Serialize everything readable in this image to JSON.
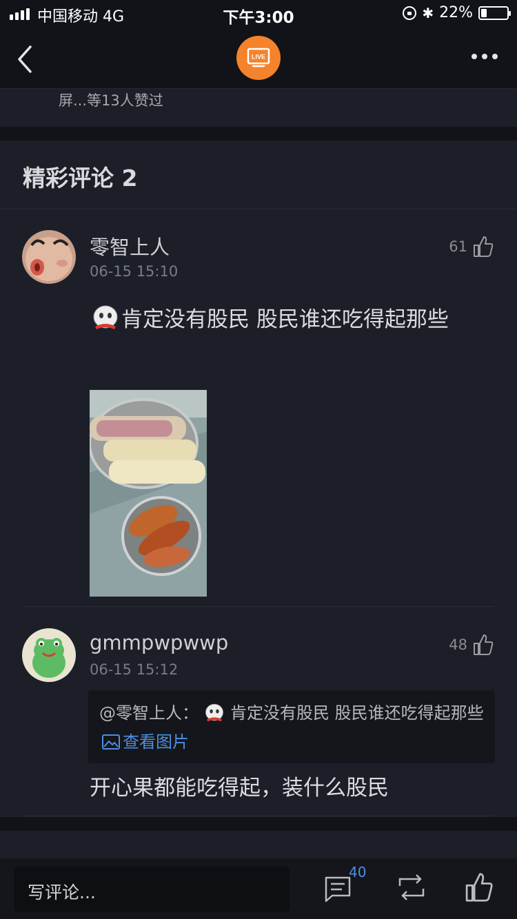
{
  "status_bar": {
    "carrier": "中国移动  4G",
    "time": "下午3:00",
    "battery": "22%",
    "battery_level": 0.22
  },
  "nav": {
    "badge_label": "LIVE"
  },
  "liked_by": "屏...等13人赞过",
  "section": {
    "hot_comments_title": "精彩评论 2"
  },
  "comments": [
    {
      "username": "零智上人",
      "time": "06-15 15:10",
      "likes": "61",
      "text": "肯定没有股民 股民谁还吃得起那些"
    },
    {
      "username": "gmmpwpwwp",
      "time": "06-15 15:12",
      "likes": "48",
      "quote_prefix": "@零智上人：",
      "quote_text": "肯定没有股民 股民谁还吃得起那些",
      "quote_link": "查看图片",
      "text": "开心果都能吃得起，装什么股民"
    }
  ],
  "bottom_bar": {
    "input_placeholder": "写评论...",
    "comment_count": "40"
  },
  "colors": {
    "background": "#1c1f28",
    "accent": "#f5832b",
    "link": "#4d8fe0"
  }
}
